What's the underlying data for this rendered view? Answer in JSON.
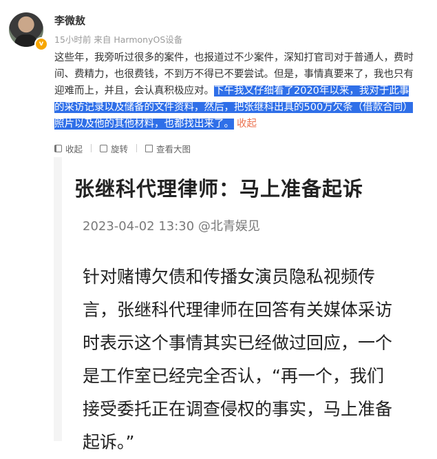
{
  "user": {
    "name": "李微敖",
    "meta": "15小时前 来自 HarmonyOS设备",
    "verified_badge": "v"
  },
  "post": {
    "lines": [
      "这些年，我旁听过很多的案件，也报道过不少案件，深知打官司对于普通人，费时",
      "间、费精力，也很费钱，不到万不得已不要尝试。但是，事情真要来了，我也只有",
      "迎难而上，并且，会认真积极应对。"
    ],
    "highlight_line3": "下午我又仔细看了2020年以来，我对于此事",
    "highlight_line4": "的采访记录以及储备的文件资料，然后，把张继科出具的500万欠条（借款合同）",
    "highlight_line5": "照片以及他的其他材料，也都找出来了。",
    "collapse_label": "收起"
  },
  "actions": {
    "collapse": "收起",
    "rotate": "旋转",
    "view_large": "查看大图"
  },
  "article": {
    "title": "张继科代理律师：马上准备起诉",
    "meta": "2023-04-02 13:30 @北青娱见",
    "body_lines": [
      "针对赌博欠债和传播女演员隐私视频传",
      "言，张继科代理律师在回答有关媒体采访",
      "时表示这个事情其实已经做过回应，一个",
      "是工作室已经完全否认，“再一个，我们",
      "接受委托正在调查侵权的事实，马上准备",
      "起诉。”"
    ]
  }
}
